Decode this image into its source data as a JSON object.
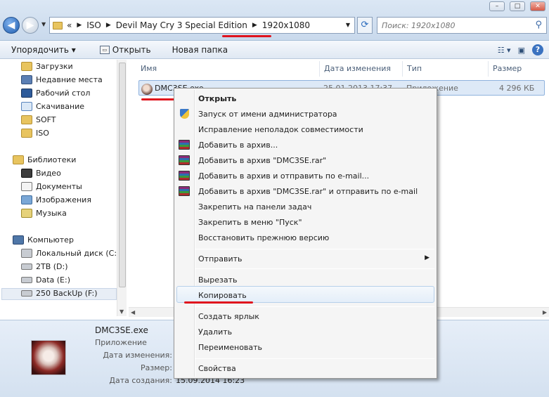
{
  "window": {
    "minimize_label": "–",
    "maximize_label": "□",
    "close_label": "✕"
  },
  "address": {
    "path": [
      "ISO",
      "Devil May Cry 3 Special Edition",
      "1920x1080"
    ],
    "overflow_label": "«"
  },
  "search": {
    "placeholder": "Поиск: 1920x1080"
  },
  "toolbar": {
    "organize": "Упорядочить ▾",
    "open": "Открыть",
    "new_folder": "Новая папка"
  },
  "sidebar": {
    "favorites": [
      "Загрузки",
      "Недавние места",
      "Рабочий стол",
      "Скачивание",
      "SOFT",
      "ISO"
    ],
    "libraries_label": "Библиотеки",
    "libraries": [
      "Видео",
      "Документы",
      "Изображения",
      "Музыка"
    ],
    "computer_label": "Компьютер",
    "drives": [
      "Локальный диск (C:)",
      "2TB (D:)",
      "Data (E:)",
      "250 BackUp (F:)"
    ]
  },
  "columns": {
    "name": "Имя",
    "date": "Дата изменения",
    "type": "Тип",
    "size": "Размер"
  },
  "files": [
    {
      "name": "DMC3SE.exe",
      "date": "25.01.2013 17:37",
      "type": "Приложение",
      "size": "4 296 КБ"
    }
  ],
  "context_menu": {
    "items": [
      "Открыть",
      "Запуск от имени администратора",
      "Исправление неполадок совместимости",
      "Добавить в архив...",
      "Добавить в архив \"DMC3SE.rar\"",
      "Добавить в архив и отправить по e-mail...",
      "Добавить в архив \"DMC3SE.rar\" и отправить по e-mail",
      "Закрепить на панели задач",
      "Закрепить в меню \"Пуск\"",
      "Восстановить прежнюю версию",
      "Отправить",
      "Вырезать",
      "Копировать",
      "Создать ярлык",
      "Удалить",
      "Переименовать",
      "Свойства"
    ]
  },
  "details": {
    "filename": "DMC3SE.exe",
    "filetype": "Приложение",
    "modified_label": "Дата изменения:",
    "size_label": "Размер:",
    "created_label": "Дата создания:",
    "created_value": "15.09.2014 16:23"
  },
  "colors": {
    "annotation_red": "#e0141e",
    "selection_blue": "#dde9f7",
    "details_bg": "#dbe6f3"
  }
}
